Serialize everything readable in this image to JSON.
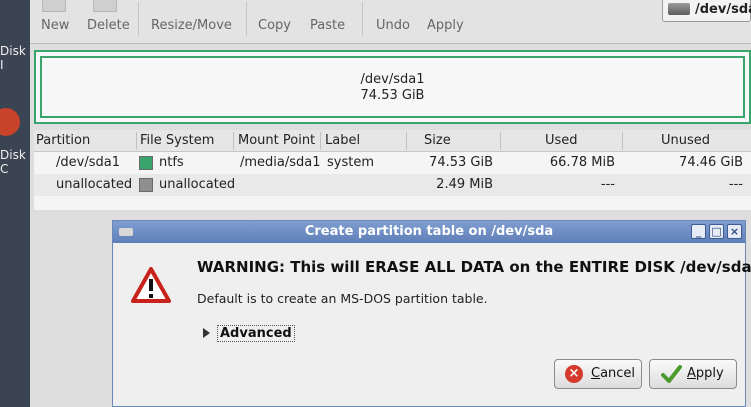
{
  "desktop": {
    "label_top": "Disk I",
    "label_mid": "Disk C"
  },
  "toolbar": {
    "new_label": "New",
    "delete_label": "Delete",
    "resize_label": "Resize/Move",
    "copy_label": "Copy",
    "paste_label": "Paste",
    "undo_label": "Undo",
    "apply_label": "Apply",
    "device": "/dev/sda"
  },
  "partition_visual": {
    "name": "/dev/sda1",
    "size": "74.53 GiB"
  },
  "partition_table": {
    "headers": [
      "Partition",
      "File System",
      "Mount Point",
      "Label",
      "Size",
      "Used",
      "Unused"
    ],
    "rows": [
      {
        "partition": "/dev/sda1",
        "filesystem": "ntfs",
        "mount_point": "/media/sda1",
        "label": "system",
        "size": "74.53 GiB",
        "used": "66.78 MiB",
        "unused": "74.46 GiB",
        "color": "#3aa46d"
      },
      {
        "partition": "unallocated",
        "filesystem": "unallocated",
        "mount_point": "",
        "label": "",
        "size": "2.49 MiB",
        "used": "---",
        "unused": "---",
        "color": "#8f8f8f"
      }
    ]
  },
  "dialog": {
    "title": "Create partition table on /dev/sda",
    "warning": "WARNING:  This will ERASE ALL DATA on the ENTIRE DISK /dev/sda",
    "subtext": "Default is to create an MS-DOS partition table.",
    "advanced_label": "Advanced",
    "cancel_mnemonic": "C",
    "cancel_rest": "ancel",
    "apply_mnemonic": "A",
    "apply_rest": "pply",
    "title_color": "#6a87b8"
  }
}
